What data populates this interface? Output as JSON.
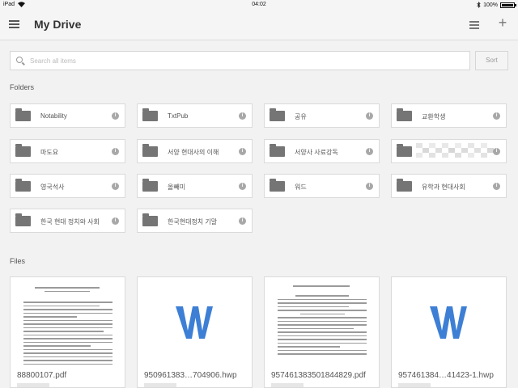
{
  "status": {
    "device": "iPad",
    "time": "04:02",
    "battery": "100%"
  },
  "header": {
    "title": "My Drive"
  },
  "search": {
    "placeholder": "Search all items",
    "sort_label": "Sort"
  },
  "folders_label": "Folders",
  "folders": [
    {
      "name": "Notability"
    },
    {
      "name": "TxtPub"
    },
    {
      "name": "공유"
    },
    {
      "name": "교환학생"
    },
    {
      "name": "마도요"
    },
    {
      "name": "서양 현대사의 이해"
    },
    {
      "name": "서양사 사료강독"
    },
    {
      "name": ""
    },
    {
      "name": "영국석사"
    },
    {
      "name": "올빼미"
    },
    {
      "name": "워드"
    },
    {
      "name": "유학과 현대사회"
    },
    {
      "name": "한국 현대 정치와 사회"
    },
    {
      "name": "한국현대정치 기말"
    }
  ],
  "files_label": "Files",
  "files": [
    {
      "name": "88800107.pdf",
      "kind": "pdf"
    },
    {
      "name": "950961383…704906.hwp",
      "kind": "word"
    },
    {
      "name": "957461383501844829.pdf",
      "kind": "pdf"
    },
    {
      "name": "957461384…41423-1.hwp",
      "kind": "word"
    }
  ],
  "colors": {
    "word_blue": "#3d7fd5",
    "folder_gray": "#757575"
  }
}
